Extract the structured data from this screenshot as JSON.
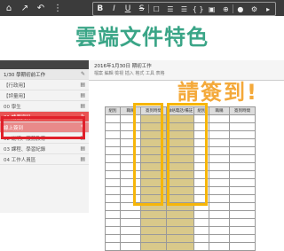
{
  "toolbar": {
    "buttons": [
      {
        "name": "home-icon",
        "glyph": "⌂"
      },
      {
        "name": "share-icon",
        "glyph": "↗"
      },
      {
        "name": "undo-icon",
        "glyph": "↶"
      },
      {
        "name": "more-icon",
        "glyph": "⋮"
      }
    ],
    "format": [
      "B",
      "I",
      "U",
      "S",
      "☐",
      "☰",
      "☰",
      "{ }",
      "▣",
      "⊕"
    ],
    "right": [
      "●",
      "⚙",
      "▸"
    ]
  },
  "headline": "雲端文件特色",
  "sidebar": {
    "header": "",
    "items": [
      {
        "label": "1/30 學期初前工作",
        "icon": "✎",
        "kind": "sec"
      },
      {
        "label": "【行政用】",
        "icon": "▤",
        "kind": "normal"
      },
      {
        "label": "【評量用】",
        "icon": "▤",
        "kind": "normal"
      },
      {
        "label": "00 學生",
        "icon": "▤",
        "kind": "normal"
      },
      {
        "label": "01 請假資料",
        "icon": "✎",
        "kind": "active"
      },
      {
        "label": "線上簽到",
        "icon": "✎",
        "kind": "active2"
      },
      {
        "label": "02 說明、服務教育",
        "icon": "▤",
        "kind": "normal"
      },
      {
        "label": "03 課程、學習紀錄",
        "icon": "▤",
        "kind": "normal"
      },
      {
        "label": "04 工作人員區",
        "icon": "▤",
        "kind": "normal"
      }
    ]
  },
  "document": {
    "title": "2016年1月30日 期初工作",
    "subtitle": "檔案  編輯  檢視  插入  格式  工具  表格",
    "header_row": [
      "組別",
      "職稱",
      "簽到時間",
      "聯絡電話/備註",
      "組別",
      "職稱",
      "簽到時間"
    ]
  },
  "callout": "請簽到!"
}
